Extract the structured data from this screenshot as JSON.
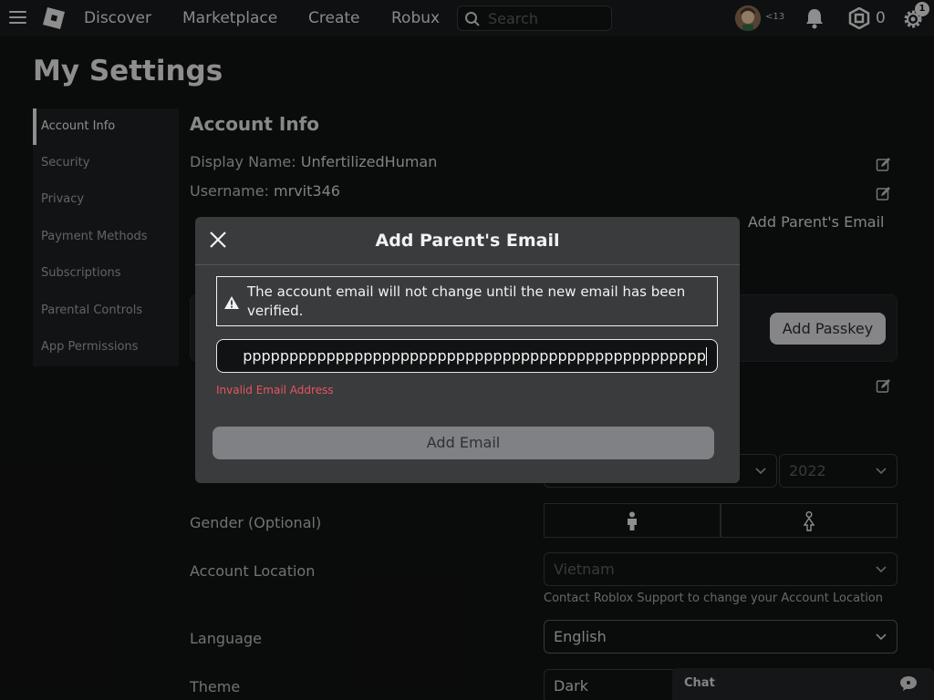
{
  "nav": {
    "links": [
      "Discover",
      "Marketplace",
      "Create",
      "Robux"
    ],
    "search_placeholder": "Search",
    "age_label": "<13",
    "robux_count": "0",
    "notification_badge": "1"
  },
  "page": {
    "title": "My Settings"
  },
  "sidebar": {
    "items": [
      {
        "label": "Account Info",
        "active": true
      },
      {
        "label": "Security"
      },
      {
        "label": "Privacy"
      },
      {
        "label": "Payment Methods"
      },
      {
        "label": "Subscriptions"
      },
      {
        "label": "Parental Controls"
      },
      {
        "label": "App Permissions"
      }
    ]
  },
  "account": {
    "section_title": "Account Info",
    "display_name_label": "Display Name:",
    "display_name_value": "UnfertilizedHuman",
    "username_label": "Username:",
    "username_value": "mrvit346",
    "add_parent_email_link": "Add Parent's Email",
    "add_passkey_button": "Add Passkey"
  },
  "form": {
    "birthday_year": "2022",
    "gender_label": "Gender (Optional)",
    "location_label": "Account Location",
    "location_value": "Vietnam",
    "location_note": "Contact Roblox Support to change your Account Location",
    "language_label": "Language",
    "language_value": "English",
    "theme_label": "Theme",
    "theme_value": "Dark"
  },
  "chat": {
    "label": "Chat"
  },
  "modal": {
    "title": "Add Parent's Email",
    "warning": "The account email will not change until the new email has been verified.",
    "input_value": "pppppppppppppppppppppppppppppppppppppppppppppppppp",
    "error": "Invalid Email Address",
    "submit_label": "Add Email"
  },
  "colors": {
    "background": "#111213",
    "nav": "#191a1c",
    "modal": "#393b3d",
    "error": "#e8545e",
    "button_disabled": "#808184"
  }
}
